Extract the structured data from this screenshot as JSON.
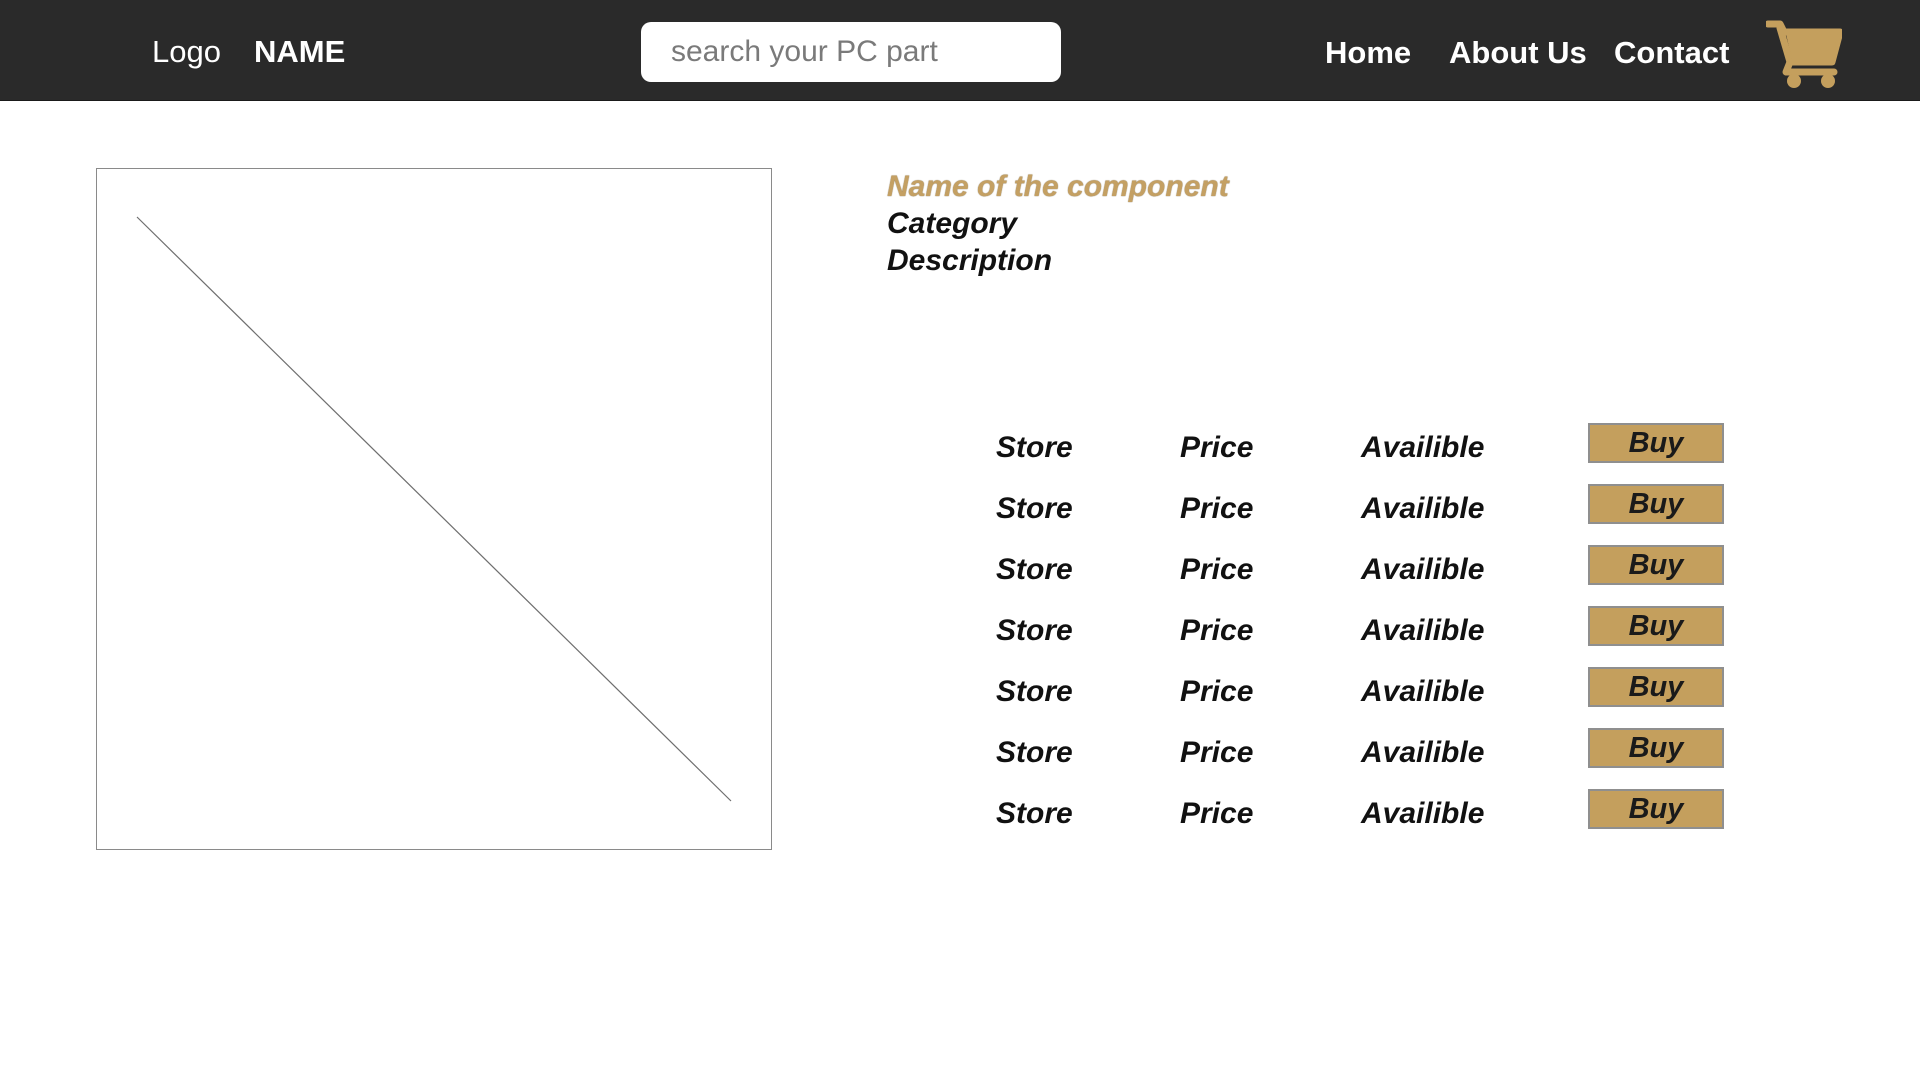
{
  "header": {
    "logo_label": "Logo",
    "brand_name": "NAME",
    "search_placeholder": "search your PC part",
    "nav": {
      "home": "Home",
      "about": "About Us",
      "contact": "Contact"
    },
    "cart_icon": "shopping-cart-icon",
    "accent_color": "#c49f5d",
    "bar_color": "#2a2a2a"
  },
  "product": {
    "image_placeholder_icon": "image-placeholder-icon",
    "name": "Name of the component",
    "category": "Category",
    "description": "Description"
  },
  "offers": [
    {
      "store": "Store",
      "price": "Price",
      "availability": "Availible",
      "buy_label": "Buy"
    },
    {
      "store": "Store",
      "price": "Price",
      "availability": "Availible",
      "buy_label": "Buy"
    },
    {
      "store": "Store",
      "price": "Price",
      "availability": "Availible",
      "buy_label": "Buy"
    },
    {
      "store": "Store",
      "price": "Price",
      "availability": "Availible",
      "buy_label": "Buy"
    },
    {
      "store": "Store",
      "price": "Price",
      "availability": "Availible",
      "buy_label": "Buy"
    },
    {
      "store": "Store",
      "price": "Price",
      "availability": "Availible",
      "buy_label": "Buy"
    },
    {
      "store": "Store",
      "price": "Price",
      "availability": "Availible",
      "buy_label": "Buy"
    }
  ]
}
